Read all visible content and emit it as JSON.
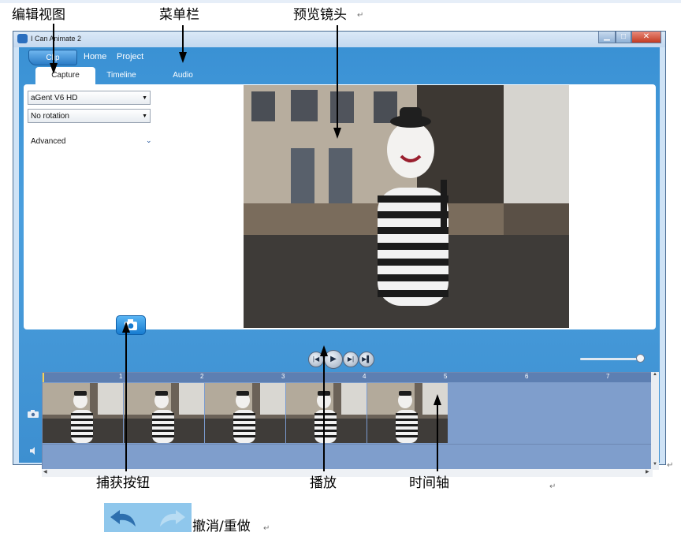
{
  "annotations": {
    "edit_view": "编辑视图",
    "menu_bar": "菜单栏",
    "preview_lens": "预览镜头",
    "capture_button": "捕获按钮",
    "play": "播放",
    "timeline": "时间轴",
    "undo_redo": "撤消/重做"
  },
  "window": {
    "title": "I Can Animate 2",
    "controls": [
      "minimize-icon",
      "maximize-icon",
      "close-icon"
    ]
  },
  "toolbar": {
    "clip_label": "Clip",
    "menu": [
      "Home",
      "Project"
    ]
  },
  "tabs": [
    "Capture",
    "Timeline",
    "Audio"
  ],
  "capture_panel": {
    "camera_select": "aGent V6 HD",
    "rotation_select": "No rotation",
    "advanced_label": "Advanced"
  },
  "timeline": {
    "ruler_ticks": [
      "1",
      "2",
      "3",
      "4",
      "5",
      "6",
      "7"
    ],
    "frame_count": 5
  },
  "colors": {
    "accent": "#3a91d4",
    "timeline_bg": "#7f9ecc",
    "capture_button": "#1f86d6"
  }
}
